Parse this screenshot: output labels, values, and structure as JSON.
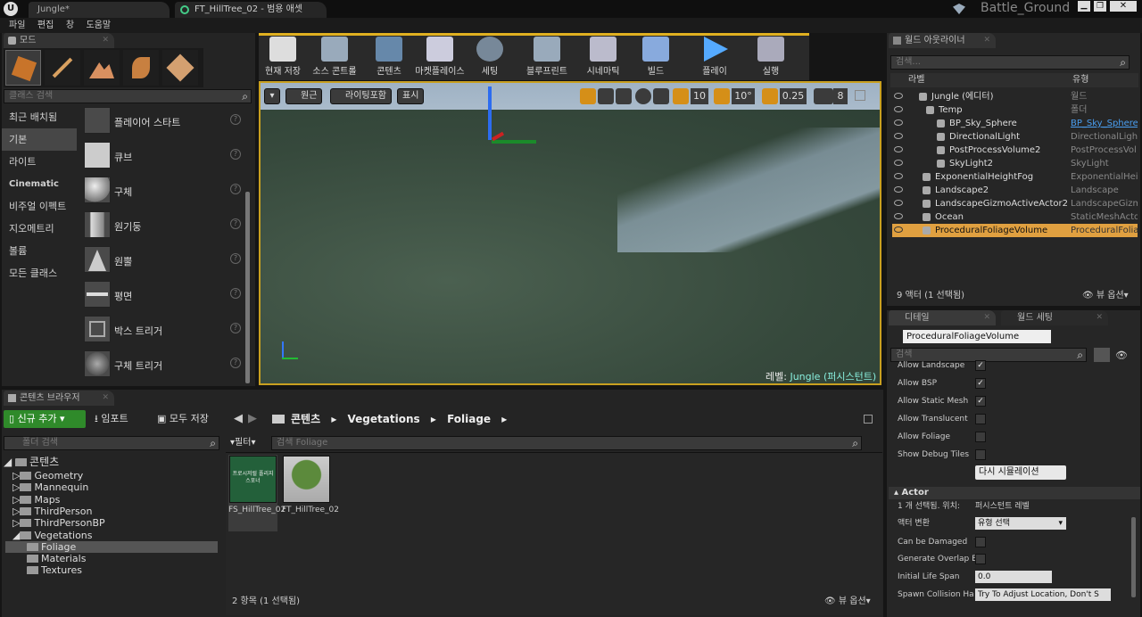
{
  "window": {
    "project": "Battle_Ground",
    "tabs": [
      "Jungle*",
      "FT_HillTree_02 - 범용 애셋"
    ]
  },
  "menu": [
    "파일",
    "편집",
    "창",
    "도움말"
  ],
  "modes": {
    "title": "모드",
    "search_placeholder": "클래스 검색",
    "categories": [
      "최근 배치됨",
      "기본",
      "라이트",
      "Cinematic",
      "비주얼 이펙트",
      "지오메트리",
      "볼륨",
      "모든 클래스"
    ],
    "items": [
      "플레이어 스타트",
      "큐브",
      "구체",
      "원기둥",
      "원뿔",
      "평면",
      "박스 트리거",
      "구체 트리거"
    ]
  },
  "toolbar": [
    "현재 저장",
    "소스 콘트롤",
    "콘텐츠",
    "마켓플레이스",
    "세팅",
    "블루프린트",
    "시네마틱",
    "빌드",
    "플레이",
    "실행"
  ],
  "viewport": {
    "perspective": "원근",
    "lighting": "라이팅포함",
    "show": "표시",
    "grid": "10",
    "rot": "10°",
    "scale": "0.25",
    "cam": "8",
    "level_label": "레벨:",
    "level_name": "Jungle (퍼시스턴트)"
  },
  "outliner": {
    "title": "월드 아웃라이너",
    "search_placeholder": "검색...",
    "col_label": "라벨",
    "col_type": "유형",
    "rows": [
      {
        "label": "Jungle (에디터)",
        "type": "월드"
      },
      {
        "label": "Temp",
        "type": "폴더"
      },
      {
        "label": "BP_Sky_Sphere",
        "type": "BP_Sky_Sphere"
      },
      {
        "label": "DirectionalLight",
        "type": "DirectionalLight"
      },
      {
        "label": "PostProcessVolume2",
        "type": "PostProcessVol"
      },
      {
        "label": "SkyLight2",
        "type": "SkyLight"
      },
      {
        "label": "ExponentialHeightFog",
        "type": "ExponentialHeig"
      },
      {
        "label": "Landscape2",
        "type": "Landscape"
      },
      {
        "label": "LandscapeGizmoActiveActor2",
        "type": "LandscapeGizm"
      },
      {
        "label": "Ocean",
        "type": "StaticMeshActor"
      },
      {
        "label": "ProceduralFoliageVolume",
        "type": "ProceduralFolia"
      }
    ],
    "status": "9 액터 (1 선택됨)",
    "view_options": "뷰 옵션"
  },
  "details": {
    "tab1": "디테일",
    "tab2": "월드 세팅",
    "object": "ProceduralFoliageVolume",
    "search_placeholder": "검색",
    "props": [
      {
        "name": "Allow Landscape",
        "checked": true
      },
      {
        "name": "Allow BSP",
        "checked": true
      },
      {
        "name": "Allow Static Mesh",
        "checked": true
      },
      {
        "name": "Allow Translucent",
        "checked": false
      },
      {
        "name": "Allow Foliage",
        "checked": false
      },
      {
        "name": "Show Debug Tiles",
        "checked": false
      }
    ],
    "resimulate": "다시 시뮬레이션",
    "actor_section": "Actor",
    "selected_info": "1 개 선택됨. 위치:",
    "selected_value": "퍼시스턴트 레벨",
    "convert_label": "액터 변환",
    "convert_value": "유형 선택",
    "can_damage": "Can be Damaged",
    "gen_overlap": "Generate Overlap E",
    "life_span": "Initial Life Span",
    "life_value": "0.0",
    "spawn": "Spawn Collision Ha",
    "spawn_value": "Try To Adjust Location, Don't S"
  },
  "content": {
    "title": "콘텐츠 브라우저",
    "add_new": "신규 추가",
    "import": "임포트",
    "save_all": "모두 저장",
    "path": [
      "콘텐츠",
      "Vegetations",
      "Foliage"
    ],
    "folder_search": "폴더 검색",
    "filter": "필터",
    "asset_search": "검색 Foliage",
    "tree": [
      "콘텐츠",
      "Geometry",
      "Mannequin",
      "Maps",
      "ThirdPerson",
      "ThirdPersonBP",
      "Vegetations",
      "Foliage",
      "Materials",
      "Textures"
    ],
    "assets": [
      {
        "name": "FS_HillTree_02",
        "thumb_text": "프로시저럴 폴리지 스포너"
      },
      {
        "name": "FT_HillTree_02"
      }
    ],
    "status": "2 항목 (1 선택됨)",
    "view_options": "뷰 옵션"
  }
}
